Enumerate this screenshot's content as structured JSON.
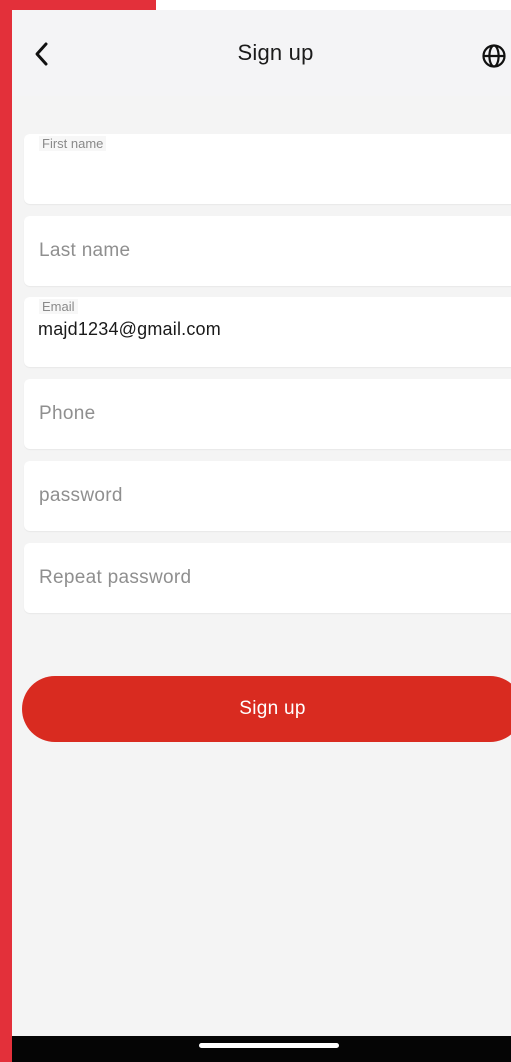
{
  "header": {
    "title": "Sign up",
    "back_icon": "chevron-left-icon",
    "language_icon": "globe-icon"
  },
  "form": {
    "first_name": {
      "label": "First name",
      "value": ""
    },
    "last_name": {
      "placeholder": "Last name"
    },
    "email": {
      "label": "Email",
      "value": "majd1234@gmail.com"
    },
    "phone": {
      "placeholder": "Phone"
    },
    "password": {
      "placeholder": "password"
    },
    "repeat_password": {
      "placeholder": "Repeat password"
    }
  },
  "submit": {
    "label": "Sign up"
  },
  "colors": {
    "accent": "#d92b20",
    "frame_red": "#e3303a",
    "background": "#f4f4f4",
    "field_bg": "#ffffff"
  }
}
